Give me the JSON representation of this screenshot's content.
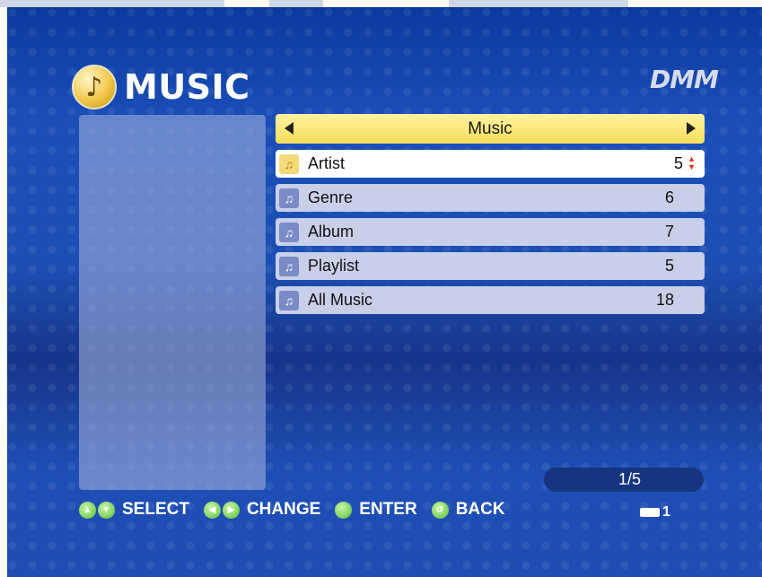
{
  "header": {
    "title": "MUSIC",
    "brand": "DMM"
  },
  "menu": {
    "category": "Music",
    "items": [
      {
        "label": "Artist",
        "count": "5",
        "selected": true
      },
      {
        "label": "Genre",
        "count": "6"
      },
      {
        "label": "Album",
        "count": "7"
      },
      {
        "label": "Playlist",
        "count": "5"
      },
      {
        "label": "All Music",
        "count": "18"
      }
    ]
  },
  "page_indicator": "1/5",
  "footer": {
    "select": "SELECT",
    "change": "CHANGE",
    "enter": "ENTER",
    "back": "BACK",
    "disc": "1"
  },
  "colors": {
    "background": "#1c4fb4",
    "header_bar": "#f6de5c",
    "row": "#c8cfe8",
    "selected_row": "#ffffff",
    "footer_button": "#5ac036"
  }
}
